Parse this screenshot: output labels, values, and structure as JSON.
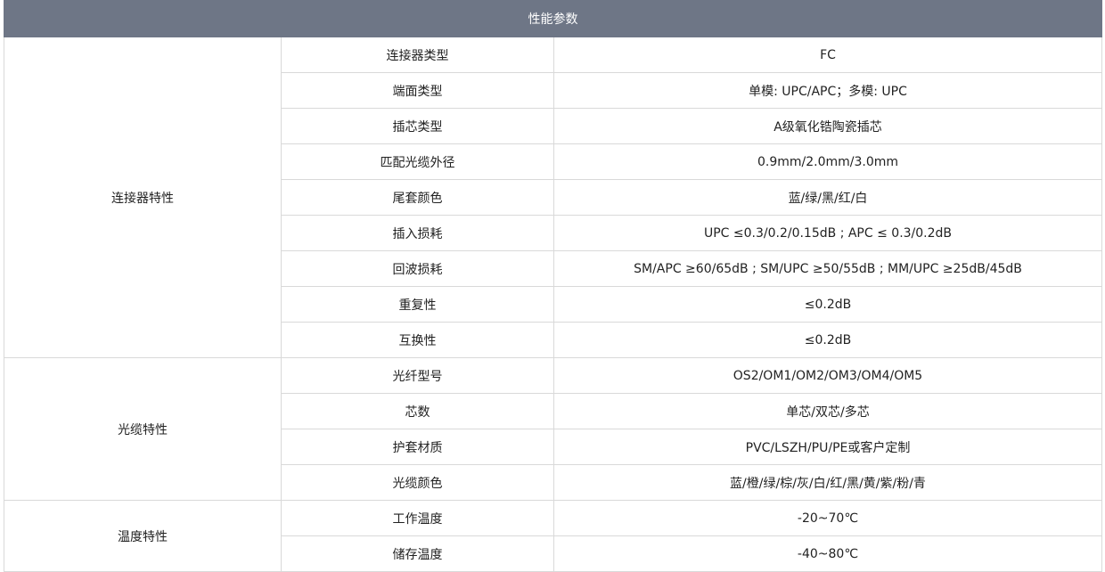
{
  "header": "性能参数",
  "groups": [
    {
      "name": "连接器特性",
      "rows": [
        {
          "param": "连接器类型",
          "value": "FC"
        },
        {
          "param": "端面类型",
          "value": "单模: UPC/APC；多模: UPC"
        },
        {
          "param": "插芯类型",
          "value": "A级氧化锆陶瓷插芯"
        },
        {
          "param": "匹配光缆外径",
          "value": "0.9mm/2.0mm/3.0mm"
        },
        {
          "param": "尾套颜色",
          "value": "蓝/绿/黑/红/白"
        },
        {
          "param": "插入损耗",
          "value": "UPC ≤0.3/0.2/0.15dB ; APC ≤  0.3/0.2dB"
        },
        {
          "param": "回波损耗",
          "value": "SM/APC ≥60/65dB ; SM/UPC ≥50/55dB ; MM/UPC ≥25dB/45dB"
        },
        {
          "param": "重复性",
          "value": "≤0.2dB"
        },
        {
          "param": "互换性",
          "value": "≤0.2dB"
        }
      ]
    },
    {
      "name": "光缆特性",
      "rows": [
        {
          "param": "光纤型号",
          "value": "OS2/OM1/OM2/OM3/OM4/OM5"
        },
        {
          "param": "芯数",
          "value": "单芯/双芯/多芯"
        },
        {
          "param": "护套材质",
          "value": "PVC/LSZH/PU/PE或客户定制"
        },
        {
          "param": "光缆颜色",
          "value": "蓝/橙/绿/棕/灰/白/红/黑/黄/紫/粉/青"
        }
      ]
    },
    {
      "name": "温度特性",
      "rows": [
        {
          "param": "工作温度",
          "value": "-20~70℃"
        },
        {
          "param": "储存温度",
          "value": "-40~80℃"
        }
      ]
    }
  ]
}
